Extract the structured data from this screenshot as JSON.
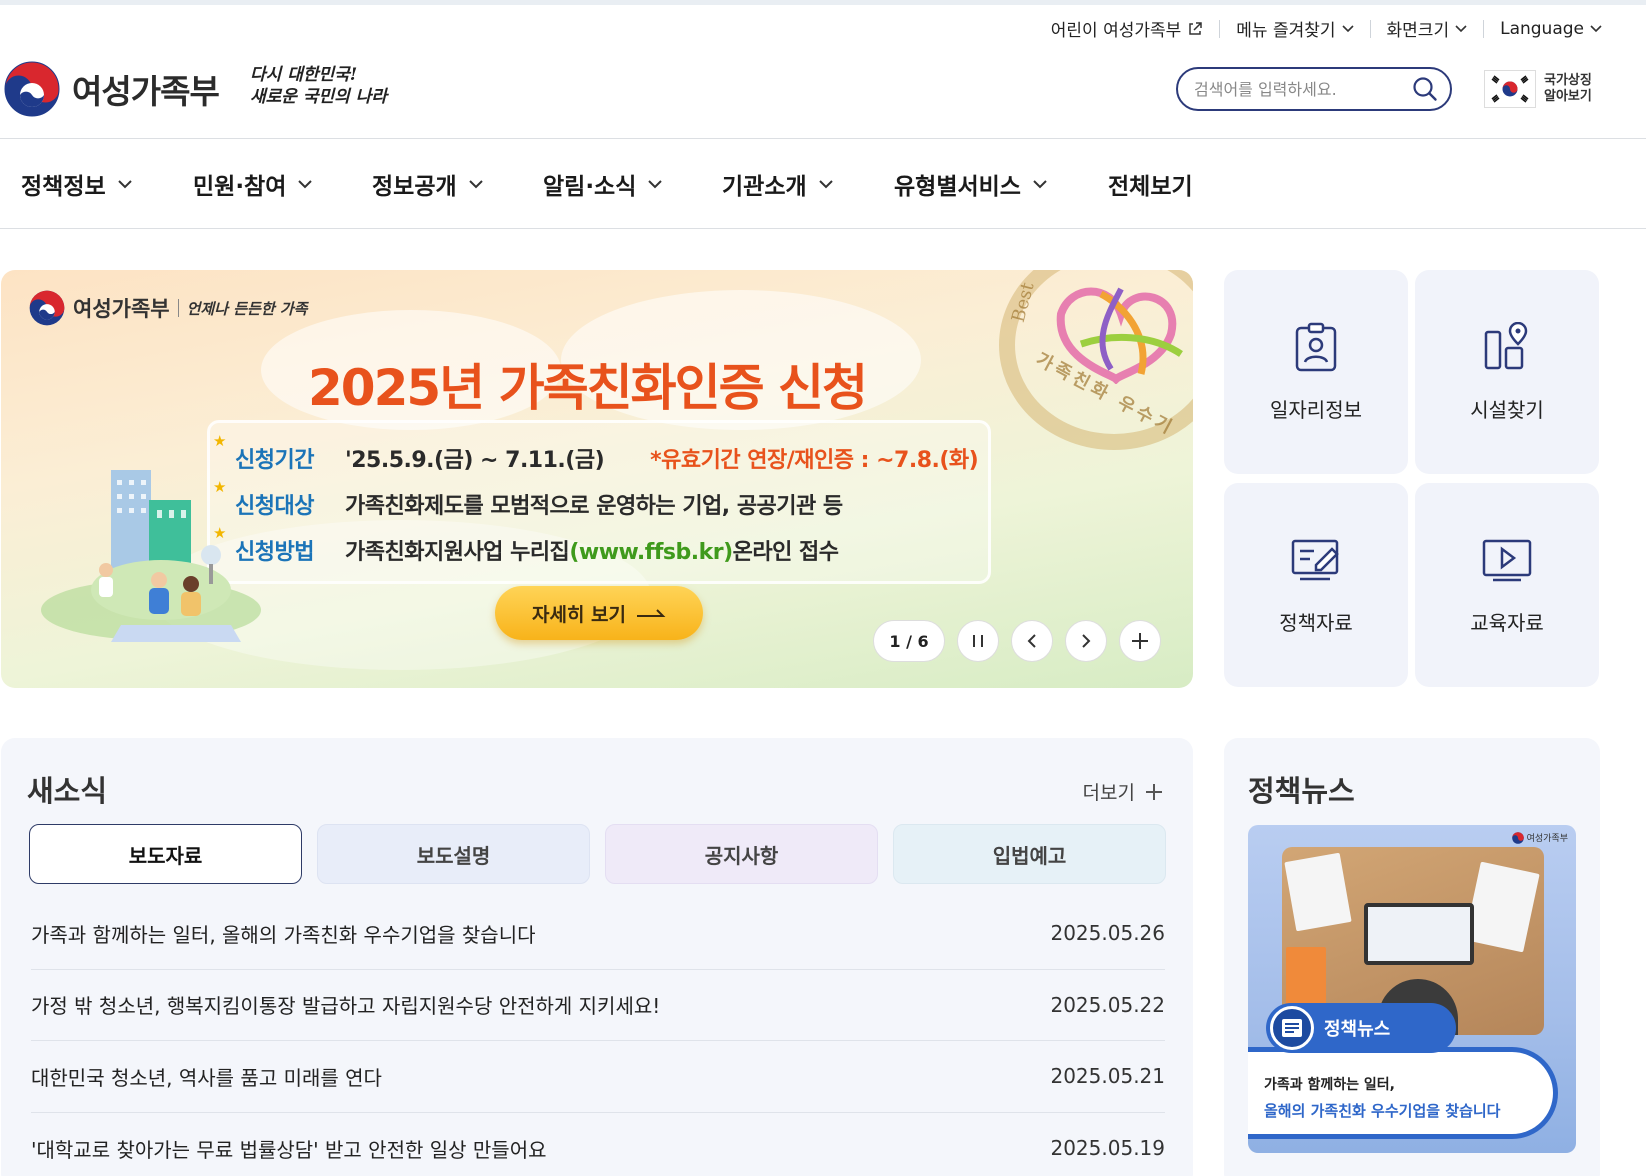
{
  "utility": {
    "kids": "어린이 여성가족부",
    "favorites": "메뉴 즐겨찾기",
    "screen_size": "화면크기",
    "language": "Language"
  },
  "header": {
    "brand": "여성가족부",
    "slogan_line1": "다시 대한민국!",
    "slogan_line2": "새로운 국민의 나라",
    "search_placeholder": "검색어를 입력하세요.",
    "national_symbol": "국가상징 알아보기"
  },
  "gnb": [
    {
      "label": "정책정보"
    },
    {
      "label": "민원·참여"
    },
    {
      "label": "정보공개"
    },
    {
      "label": "알림·소식"
    },
    {
      "label": "기관소개"
    },
    {
      "label": "유형별서비스"
    },
    {
      "label": "전체보기"
    }
  ],
  "banner": {
    "logo_name": "여성가족부",
    "logo_slogan": "언제나 든든한 가족",
    "title": "2025년 가족친화인증 신청",
    "rows": [
      {
        "key": "신청기간",
        "value": "'25.5.9.(금) ~ 7.11.(금)",
        "note": "*유효기간 연장/재인증 : ~7.8.(화)"
      },
      {
        "key": "신청대상",
        "value": "가족친화제도를 모범적으로 운영하는 기업, 공공기관 등"
      },
      {
        "key": "신청방법",
        "value_pre": "가족친화지원사업 누리집",
        "url": "(www.ffsb.kr)",
        "value_post": " 온라인 접수"
      }
    ],
    "button": "자세히 보기",
    "seal_top": "Best",
    "seal_text": "가족친화 우수기",
    "page": "1 / 6"
  },
  "quick": [
    {
      "label": "일자리정보",
      "icon": "id-badge-icon"
    },
    {
      "label": "시설찾기",
      "icon": "location-building-icon"
    },
    {
      "label": "정책자료",
      "icon": "document-edit-icon"
    },
    {
      "label": "교육자료",
      "icon": "video-play-icon"
    }
  ],
  "news": {
    "title": "새소식",
    "more": "더보기",
    "tabs": [
      "보도자료",
      "보도설명",
      "공지사항",
      "입법예고"
    ],
    "items": [
      {
        "title": "가족과 함께하는 일터, 올해의 가족친화 우수기업을 찾습니다",
        "date": "2025.05.26"
      },
      {
        "title": "가정 밖 청소년, 행복지킴이통장 발급하고 자립지원수당 안전하게 지키세요!",
        "date": "2025.05.22"
      },
      {
        "title": "대한민국 청소년, 역사를 품고 미래를 연다",
        "date": "2025.05.21"
      },
      {
        "title": "'대학교로 찾아가는 무료 법률상담' 받고 안전한 일상 만들어요",
        "date": "2025.05.19"
      }
    ]
  },
  "policy_news": {
    "title": "정책뉴스",
    "card_label": "정책뉴스",
    "card_line1": "가족과 함께하는 일터,",
    "card_line2": "올해의 가족친화 우수기업을 찾습니다",
    "card_logo": "여성가족부"
  },
  "colors": {
    "brand_navy": "#2c3a7a",
    "banner_title": "#e8521c",
    "banner_key": "#1b74b8",
    "tile_bg": "#f1f3fa"
  }
}
